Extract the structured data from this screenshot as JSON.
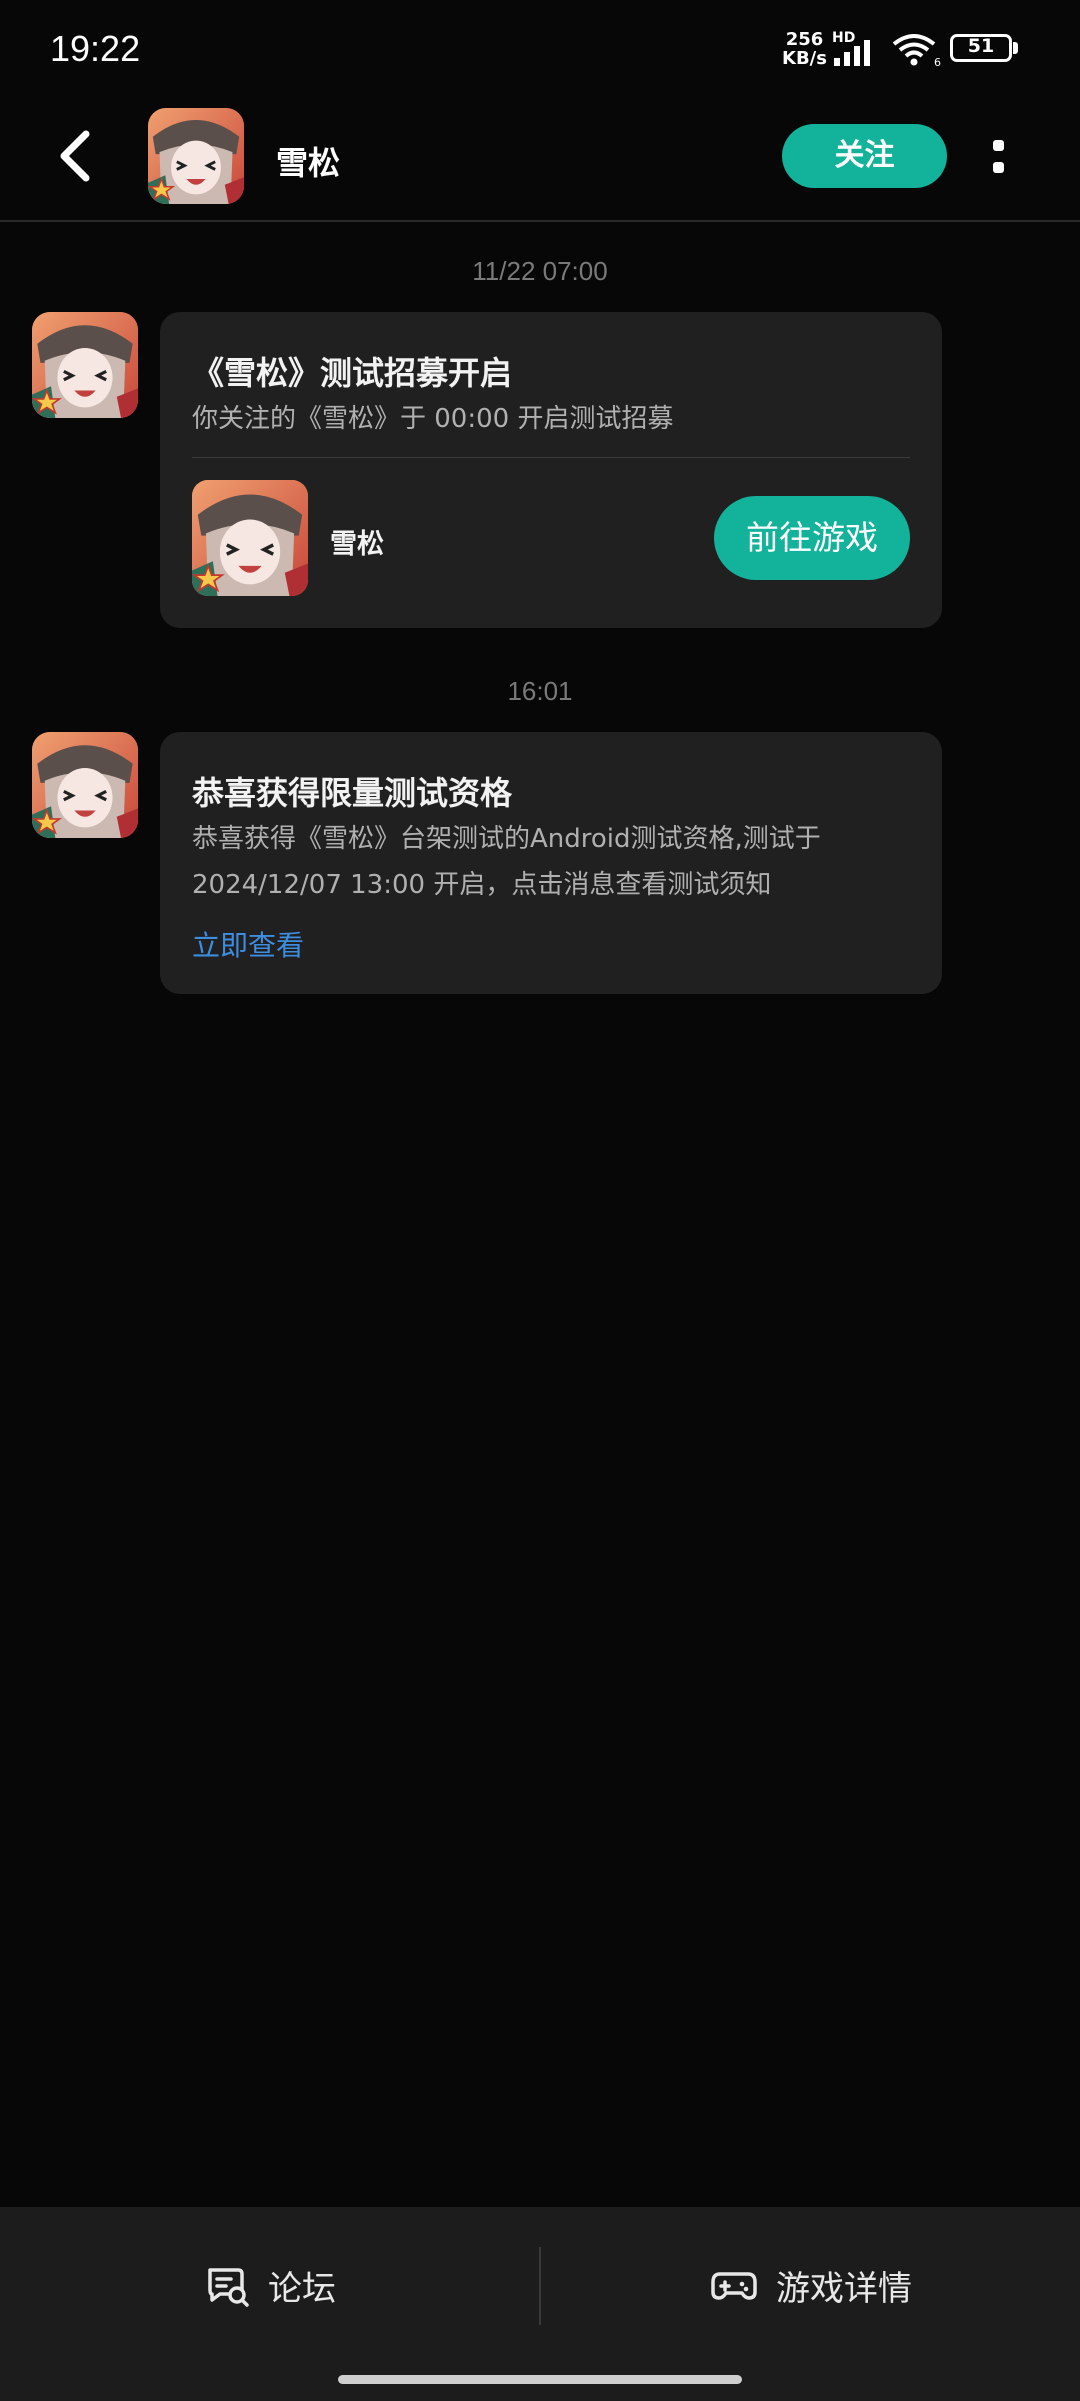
{
  "status_bar": {
    "time": "19:22",
    "net_speed_value": "256",
    "net_speed_unit": "KB/s",
    "hd_label": "HD",
    "wifi_sub": "6",
    "battery": "51",
    "battery_level": 0.51
  },
  "header": {
    "title": "雪松",
    "follow_label": "关注",
    "icons": [
      "back-arrow-icon",
      "more-options-icon"
    ]
  },
  "messages": [
    {
      "timestamp": "11/22  07:00",
      "title": "《雪松》测试招募开启",
      "subtitle": "你关注的《雪松》于 00:00 开启测试招募",
      "game_name": "雪松",
      "button_label": "前往游戏"
    },
    {
      "timestamp": "16:01",
      "title": "恭喜获得限量测试资格",
      "body_line1": "恭喜获得《雪松》台架测试的Android测试资格,测试于",
      "body_line2": "2024/12/07 13:00 开启，点击消息查看测试须知",
      "link_label": "立即查看"
    }
  ],
  "bottom_bar": {
    "forum_label": "论坛",
    "game_details_label": "游戏详情"
  },
  "colors": {
    "accent": "#13b29a",
    "link": "#3d8de0",
    "card": "#202020",
    "background": "#070707"
  }
}
